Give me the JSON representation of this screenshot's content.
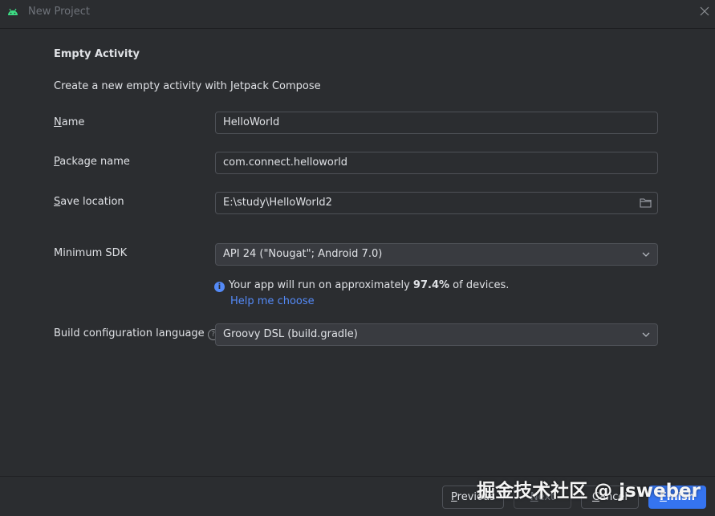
{
  "window": {
    "title": "New Project"
  },
  "content": {
    "heading": "Empty Activity",
    "description": "Create a new empty activity with Jetpack Compose",
    "name_label_mn": "N",
    "name_label_rest": "ame",
    "name_value": "HelloWorld",
    "package_label_mn": "P",
    "package_label_rest": "ackage name",
    "package_value": "com.connect.helloworld",
    "save_label_mn": "S",
    "save_label_rest": "ave location",
    "save_value": "E:\\study\\HelloWorld2",
    "min_sdk_label": "Minimum SDK",
    "min_sdk_value": "API 24 (\"Nougat\"; Android 7.0)",
    "info_prefix": "Your app will run on approximately ",
    "info_percent": "97.4%",
    "info_suffix": " of devices.",
    "help_link": "Help me choose",
    "build_lang_label": "Build configuration language",
    "build_lang_value": "Groovy DSL (build.gradle)"
  },
  "footer": {
    "previous_mn": "P",
    "previous_rest": "revious",
    "next_mn": "N",
    "next_rest": "ext",
    "cancel_mn": "C",
    "cancel_rest": "ancel",
    "finish_mn": "F",
    "finish_rest": "inish"
  },
  "watermark": "掘金技术社区 @ jsweber",
  "colors": {
    "background": "#2b2d30",
    "accent": "#3574f0",
    "link": "#548af7",
    "android_green": "#3ddc84"
  }
}
